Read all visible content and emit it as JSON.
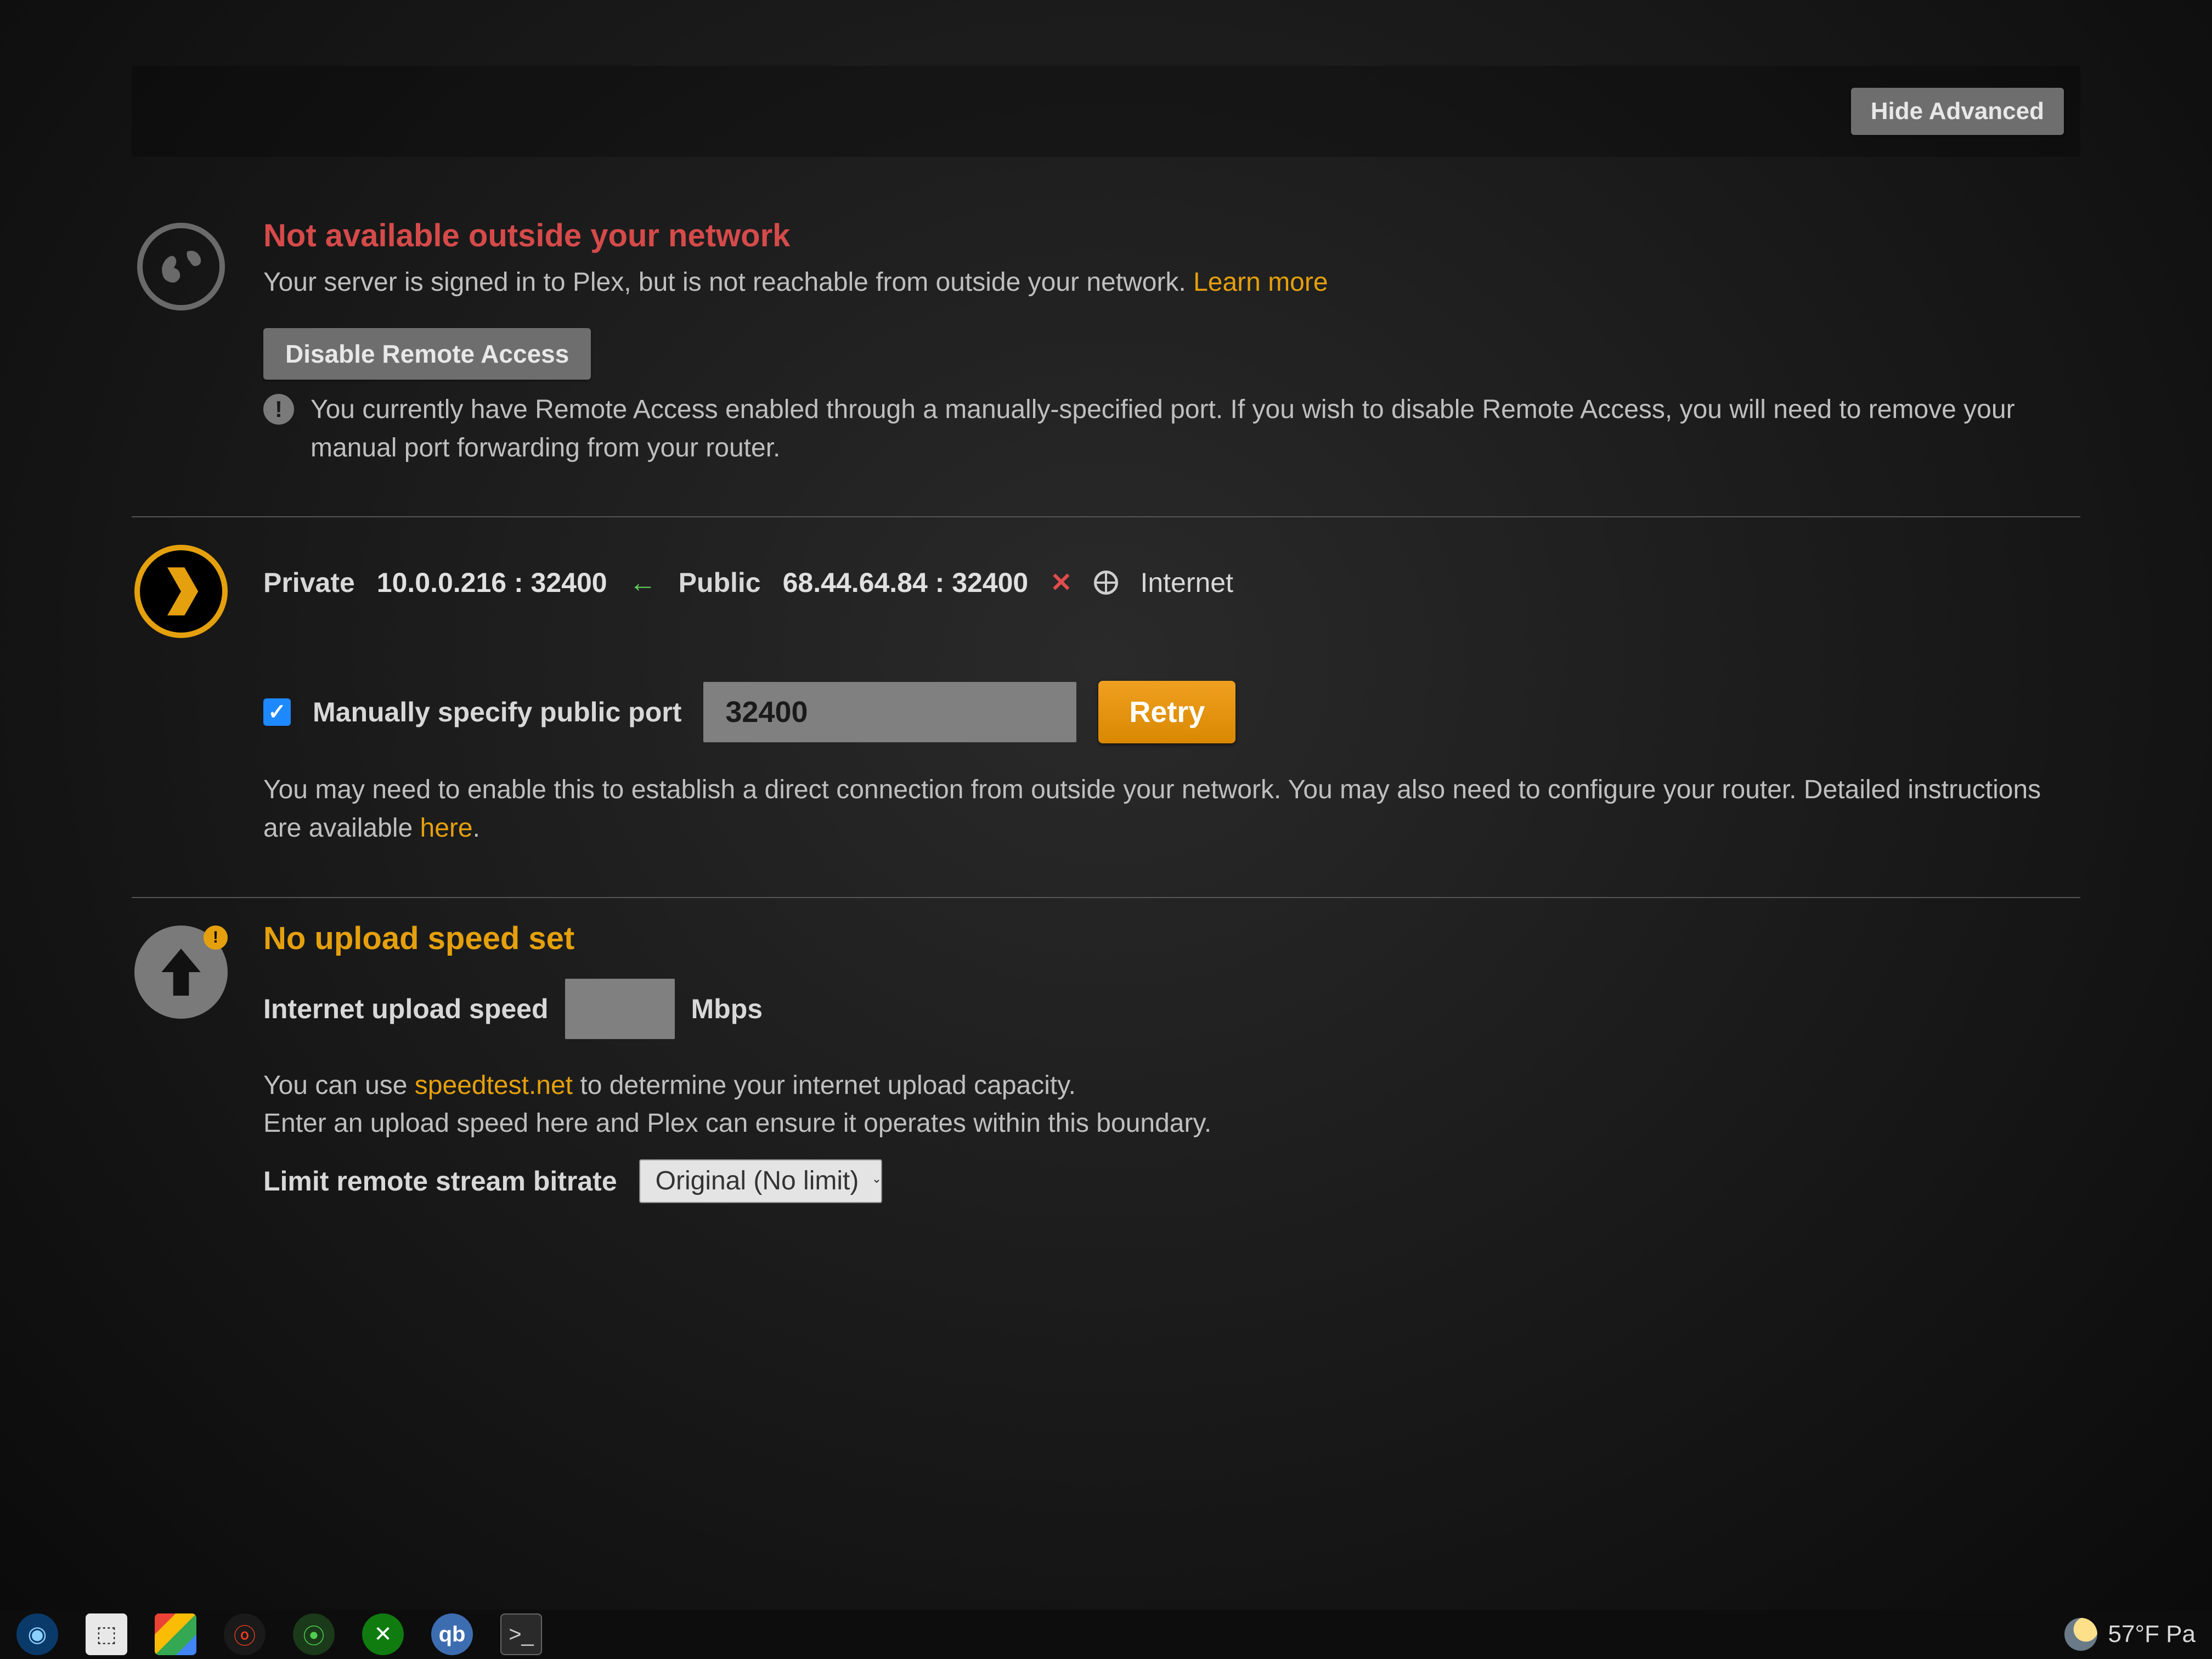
{
  "top": {
    "hide_advanced": "Hide Advanced"
  },
  "section1": {
    "title": "Not available outside your network",
    "desc_prefix": "Your server is signed in to Plex, but is not reachable from outside your network. ",
    "learn_more": "Learn more",
    "disable_btn": "Disable Remote Access",
    "info": "You currently have Remote Access enabled through a manually-specified port. If you wish to disable Remote Access, you will need to remove your manual port forwarding from your router."
  },
  "section2": {
    "private_label": "Private",
    "private_ip": "10.0.0.216 : 32400",
    "public_label": "Public",
    "public_ip": "68.44.64.84 : 32400",
    "internet_label": "Internet",
    "checkbox_label": "Manually specify public port",
    "checkbox_checked": true,
    "port_value": "32400",
    "retry": "Retry",
    "helper_prefix": "You may need to enable this to establish a direct connection from outside your network. You may also need to configure your router. Detailed instructions are available ",
    "helper_link": "here",
    "helper_suffix": "."
  },
  "section3": {
    "title": "No upload speed set",
    "speed_label": "Internet upload speed",
    "speed_unit": "Mbps",
    "speed_value": "",
    "help1_prefix": "You can use ",
    "help1_link": "speedtest.net",
    "help1_suffix": " to determine your internet upload capacity.",
    "help2": "Enter an upload speed here and Plex can ensure it operates within this boundary.",
    "bitrate_label": "Limit remote stream bitrate",
    "bitrate_value": "Original (No limit)"
  },
  "taskbar": {
    "weather": "57°F  Pa"
  }
}
